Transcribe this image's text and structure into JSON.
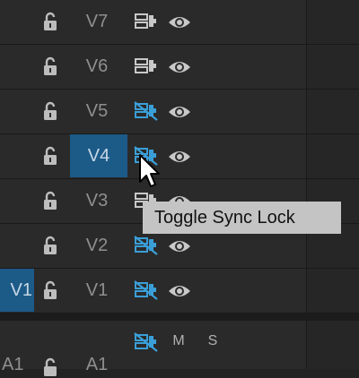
{
  "tracks": [
    {
      "label": "V7",
      "sync": "normal",
      "selected": false,
      "source": ""
    },
    {
      "label": "V6",
      "sync": "normal",
      "selected": false,
      "source": ""
    },
    {
      "label": "V5",
      "sync": "off",
      "selected": false,
      "source": ""
    },
    {
      "label": "V4",
      "sync": "off",
      "selected": true,
      "source": ""
    },
    {
      "label": "V3",
      "sync": "normal",
      "selected": false,
      "source": ""
    },
    {
      "label": "V2",
      "sync": "off",
      "selected": false,
      "source": ""
    },
    {
      "label": "V1",
      "sync": "off",
      "selected": false,
      "source": "V1"
    }
  ],
  "audio_track": {
    "label": "A1",
    "source": "A1",
    "mute_label": "M",
    "solo_label": "S"
  },
  "tooltip": {
    "text": "Toggle Sync Lock"
  },
  "icons": {
    "lock": "unlock-icon",
    "sync_normal": "sync-lock-icon",
    "sync_off": "sync-lock-off-icon",
    "eye": "eye-icon",
    "cursor": "mouse-pointer-icon"
  },
  "colors": {
    "background": "#2a2a2a",
    "selected": "#1c5a88",
    "sync_off_blue": "#3a9fd8",
    "label_gray": "#8f8f8f",
    "icon_gray": "#b8b8b8",
    "tooltip_bg": "#c4c4c4"
  }
}
